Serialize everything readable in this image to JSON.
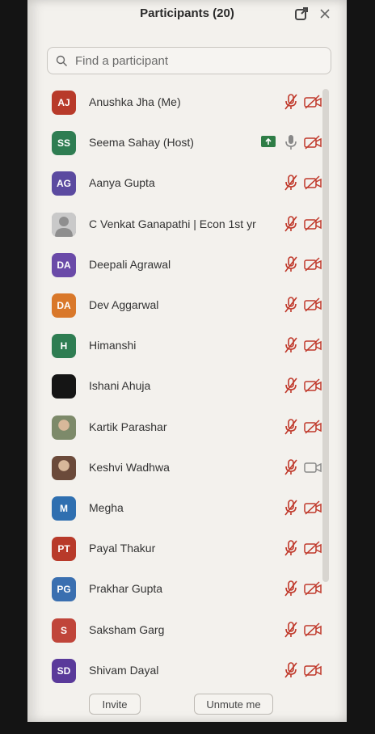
{
  "header": {
    "title": "Participants (20)"
  },
  "search": {
    "placeholder": "Find a participant"
  },
  "colors": {
    "muted_red": "#c0392b",
    "host_green": "#2e7d46",
    "panel_bg": "#f3f1ed"
  },
  "participants": [
    {
      "name": "Anushka Jha (Me)",
      "initials": "AJ",
      "avatar_color": "#b83a2a",
      "mic": "muted",
      "video": "off"
    },
    {
      "name": "Seema Sahay (Host)",
      "initials": "SS",
      "avatar_color": "#2e7d52",
      "mic": "on",
      "video": "off",
      "sharing": true
    },
    {
      "name": "Aanya Gupta",
      "initials": "AG",
      "avatar_color": "#5b4aa0",
      "mic": "muted",
      "video": "off"
    },
    {
      "name": "C Venkat Ganapathi | Econ 1st yr",
      "initials": "",
      "avatar_color": "#9a9a9a",
      "avatar_type": "default-user",
      "mic": "muted",
      "video": "off"
    },
    {
      "name": "Deepali Agrawal",
      "initials": "DA",
      "avatar_color": "#6a4aa8",
      "mic": "muted",
      "video": "off"
    },
    {
      "name": "Dev Aggarwal",
      "initials": "DA",
      "avatar_color": "#d9782a",
      "mic": "muted",
      "video": "off"
    },
    {
      "name": "Himanshi",
      "initials": "H",
      "avatar_color": "#2e7d52",
      "mic": "muted",
      "video": "off"
    },
    {
      "name": "Ishani Ahuja",
      "initials": "",
      "avatar_color": "#151515",
      "avatar_type": "photo",
      "mic": "muted",
      "video": "off"
    },
    {
      "name": "Kartik Parashar",
      "initials": "",
      "avatar_color": "#7d8a6a",
      "avatar_type": "photo",
      "mic": "muted",
      "video": "off"
    },
    {
      "name": "Keshvi Wadhwa",
      "initials": "",
      "avatar_color": "#6b4a3a",
      "avatar_type": "photo",
      "mic": "muted",
      "video": "off-gray"
    },
    {
      "name": "Megha",
      "initials": "M",
      "avatar_color": "#2f6fb0",
      "mic": "muted",
      "video": "off"
    },
    {
      "name": "Payal Thakur",
      "initials": "PT",
      "avatar_color": "#b83a2a",
      "mic": "muted",
      "video": "off"
    },
    {
      "name": "Prakhar Gupta",
      "initials": "PG",
      "avatar_color": "#3a6fb0",
      "mic": "muted",
      "video": "off"
    },
    {
      "name": "Saksham Garg",
      "initials": "S",
      "avatar_color": "#c0453a",
      "mic": "muted",
      "video": "off"
    },
    {
      "name": "Shivam Dayal",
      "initials": "SD",
      "avatar_color": "#5a3a9a",
      "mic": "muted",
      "video": "off"
    }
  ],
  "footer": {
    "invite_label": "Invite",
    "unmute_label": "Unmute me"
  }
}
